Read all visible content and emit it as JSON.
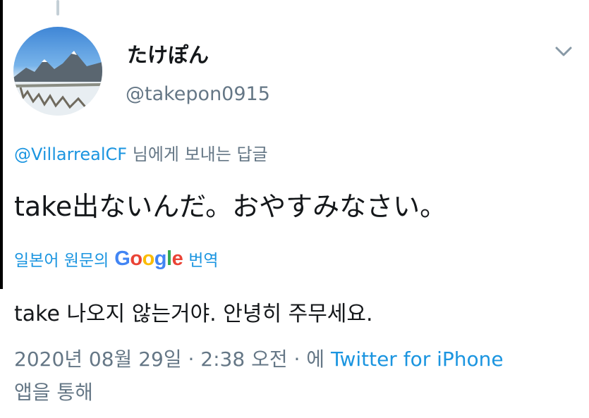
{
  "tweet": {
    "display_name": "たけぽん",
    "handle": "@takepon0915",
    "reply_mention": "@VillarrealCF",
    "reply_suffix": "님에게 보내는 답글",
    "text": "take出ないんだ。おやすみなさい。",
    "translate_prefix": "일본어 원문의",
    "translate_google": "Google",
    "translate_suffix": "번역",
    "translated_text": "take 나오지 않는거야. 안녕히 주무세요.",
    "meta_date": "2020년 08월 29일 · 2:38 오전 · 에",
    "meta_source": "Twitter for iPhone",
    "meta_tail": "앱을 통해"
  },
  "icons": {
    "avatar": "profile-photo-snowy-mountain",
    "chevron": "chevron-down-icon"
  },
  "colors": {
    "link": "#1b95e0",
    "secondary": "#657786",
    "primary_text": "#14171a"
  }
}
